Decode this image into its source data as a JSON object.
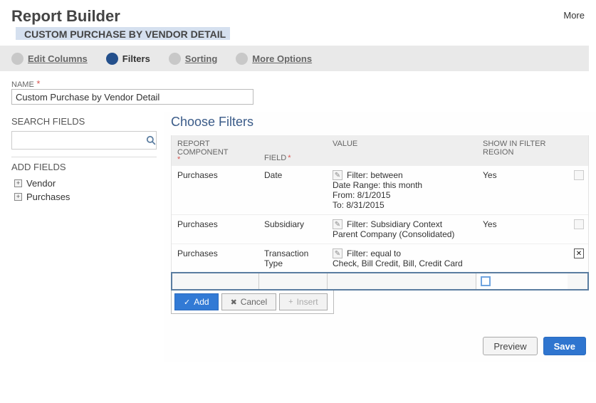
{
  "header": {
    "title": "Report Builder",
    "subtitle": "CUSTOM PURCHASE BY VENDOR DETAIL",
    "more": "More"
  },
  "wizard": {
    "edit_columns": "Edit Columns",
    "filters": "Filters",
    "sorting": "Sorting",
    "more_options": "More Options"
  },
  "nameField": {
    "label": "NAME",
    "value": "Custom Purchase by Vendor Detail"
  },
  "sidebar": {
    "search_label": "SEARCH FIELDS",
    "add_label": "ADD FIELDS",
    "fields": [
      {
        "label": "Vendor"
      },
      {
        "label": "Purchases"
      }
    ]
  },
  "filtersPanel": {
    "title": "Choose Filters",
    "columns": {
      "report_component": "REPORT COMPONENT",
      "field": "FIELD",
      "value": "VALUE",
      "show_in_filter": "SHOW IN FILTER REGION"
    },
    "rows": [
      {
        "component": "Purchases",
        "field": "Date",
        "value_lines": [
          "Filter: between",
          "Date Range: this month",
          "From: 8/1/2015",
          "To: 8/31/2015"
        ],
        "show": "Yes",
        "deletable": false
      },
      {
        "component": "Purchases",
        "field": "Subsidiary",
        "value_lines": [
          "Filter: Subsidiary Context",
          "Parent Company (Consolidated)"
        ],
        "show": "Yes",
        "deletable": false
      },
      {
        "component": "Purchases",
        "field": "Transaction Type",
        "value_lines": [
          "Filter: equal to",
          "Check, Bill Credit, Bill, Credit Card"
        ],
        "show": "",
        "deletable": true
      }
    ],
    "row_buttons": {
      "add": "Add",
      "cancel": "Cancel",
      "insert": "Insert"
    }
  },
  "footer": {
    "preview": "Preview",
    "save": "Save"
  }
}
